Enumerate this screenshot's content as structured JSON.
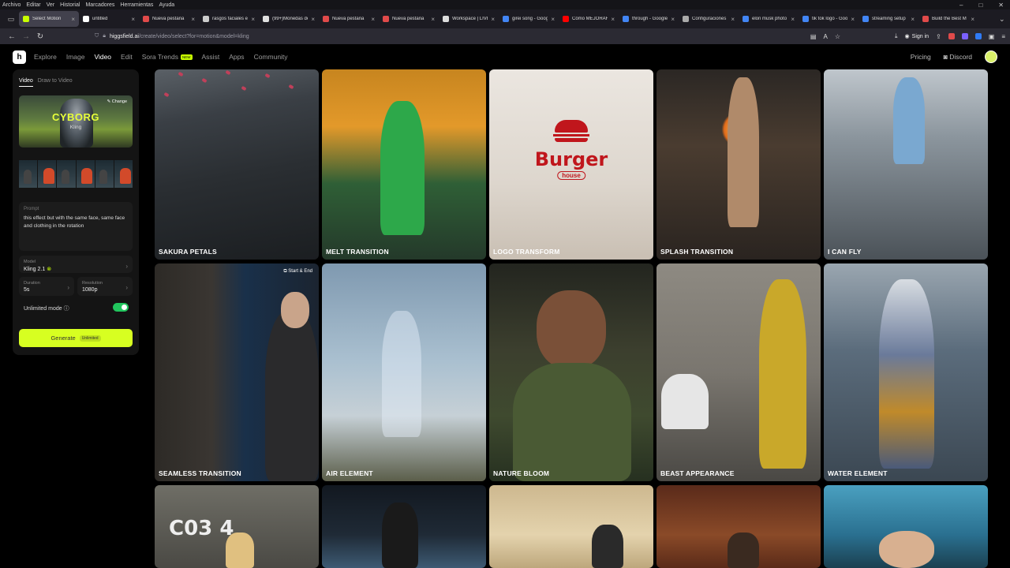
{
  "menubar": {
    "items": [
      "Archivo",
      "Editar",
      "Ver",
      "Historial",
      "Marcadores",
      "Herramientas",
      "Ayuda"
    ]
  },
  "window_controls": [
    "–",
    "□",
    "✕"
  ],
  "tabs": [
    {
      "label": "Select Motion",
      "color": "#c8ff00",
      "active": true
    },
    {
      "label": "untitled",
      "color": "#ffffff",
      "active": false
    },
    {
      "label": "Nueva pestaña",
      "color": "#e04a4a",
      "active": false
    },
    {
      "label": "rasgos faciales en",
      "color": "#cccccc",
      "active": false
    },
    {
      "label": "(99+)Monedas de",
      "color": "#e0e0e0",
      "active": false
    },
    {
      "label": "Nueva pestaña",
      "color": "#e04a4a",
      "active": false
    },
    {
      "label": "Nueva pestaña",
      "color": "#e04a4a",
      "active": false
    },
    {
      "label": "Workspace | LIVE",
      "color": "#dddddd",
      "active": false
    },
    {
      "label": "girei song - Goog",
      "color": "#4285f4",
      "active": false
    },
    {
      "label": "Cómo MEJORAR",
      "color": "#ff0000",
      "active": false
    },
    {
      "label": "through - Google",
      "color": "#4285f4",
      "active": false
    },
    {
      "label": "Configuraciones",
      "color": "#aaaaaa",
      "active": false
    },
    {
      "label": "elon musk photo",
      "color": "#4285f4",
      "active": false
    },
    {
      "label": "tik tok logo - Goo",
      "color": "#4285f4",
      "active": false
    },
    {
      "label": "streaming setup",
      "color": "#4285f4",
      "active": false
    },
    {
      "label": "Build the Best M",
      "color": "#e04a4a",
      "active": false
    }
  ],
  "address": {
    "host": "higgsfield.ai",
    "path": "/create/video/select?for=motion&model=kling"
  },
  "nav_right": {
    "signin": "Sign in"
  },
  "site": {
    "logo": "h",
    "links": [
      "Explore",
      "Image",
      "Video",
      "Edit",
      "Sora Trends",
      "Assist",
      "Apps",
      "Community"
    ],
    "active_link": "Video",
    "new_badge": "NEW",
    "pricing": "Pricing",
    "discord": "Discord"
  },
  "panel": {
    "tabs": [
      "Video",
      "Draw to Video"
    ],
    "preset": {
      "title": "CYBORG",
      "subtitle": "Kling",
      "change": "✎ Change"
    },
    "prompt_label": "Prompt",
    "prompt_text": "this effect but with the same face, same face and clothing in the rotation",
    "model_label": "Model",
    "model_value": "Kling 2.1",
    "duration_label": "Duration",
    "duration_value": "5s",
    "resolution_label": "Resolution",
    "resolution_value": "1080p",
    "unlimited_label": "Unlimited mode ⓘ",
    "unlimited_on": true,
    "generate_label": "Generate",
    "generate_badge": "Unlimited",
    "accent": "#d7ff21"
  },
  "cards": [
    "SAKURA PETALS",
    "MELT TRANSITION",
    "LOGO TRANSFORM",
    "SPLASH TRANSITION",
    "I CAN FLY",
    "SEAMLESS TRANSITION",
    "AIR ELEMENT",
    "NATURE BLOOM",
    "BEAST APPEARANCE",
    "WATER ELEMENT",
    "",
    "",
    "",
    "",
    ""
  ],
  "start_end_badge": "⧉ Start & End",
  "burger": {
    "brand": "Burger",
    "sub": "house"
  },
  "parking_sign": "C03  4"
}
